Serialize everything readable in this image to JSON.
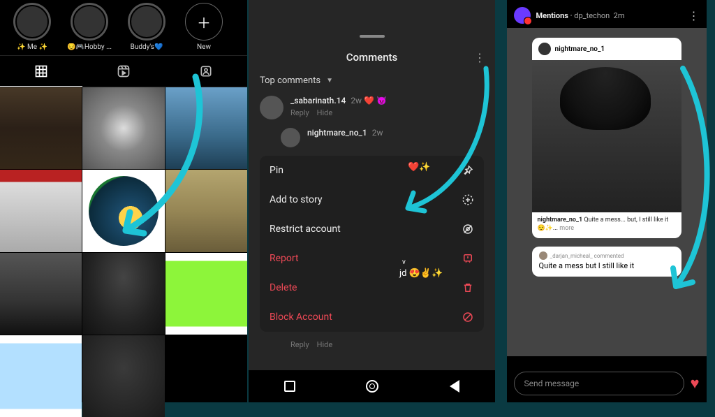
{
  "left": {
    "highlights": [
      {
        "label": "✨ Me ✨"
      },
      {
        "label": "😔🎮Hobby ..."
      },
      {
        "label": "Buddy's💙"
      },
      {
        "label": "New",
        "isNew": true
      }
    ],
    "tabs": {
      "grid": "Posts",
      "reels": "Reels",
      "tagged": "Tagged"
    }
  },
  "mid": {
    "title": "Comments",
    "sort": "Top comments",
    "c1": {
      "user": "_sabarinath.14",
      "time": "2w",
      "text": "❤️ 😈",
      "reply": "Reply",
      "hide": "Hide"
    },
    "c2": {
      "user": "nightmare_no_1",
      "time": "2w",
      "extra": "❤️✨",
      "extra2": "jd 😍✌️✨",
      "vmark": "v"
    },
    "menu": {
      "pin": "Pin",
      "addStory": "Add to story",
      "restrict": "Restrict account",
      "report": "Report",
      "delete": "Delete",
      "block": "Block Account"
    },
    "replyHide": {
      "reply": "Reply",
      "hide": "Hide"
    }
  },
  "right": {
    "header": {
      "title": "Mentions",
      "sub": "dp_techon",
      "time": "2m"
    },
    "card": {
      "user": "nightmare_no_1",
      "captionUser": "nightmare_no_1",
      "captionText": "Quite a mess... but, I still like it",
      "captionEmoji": "😌✨...",
      "more": "more"
    },
    "bubble": {
      "sub": "_darjan_micheal_ commented",
      "msg": "Quite a mess but I still like it"
    },
    "replyPlaceholder": "Send message"
  }
}
